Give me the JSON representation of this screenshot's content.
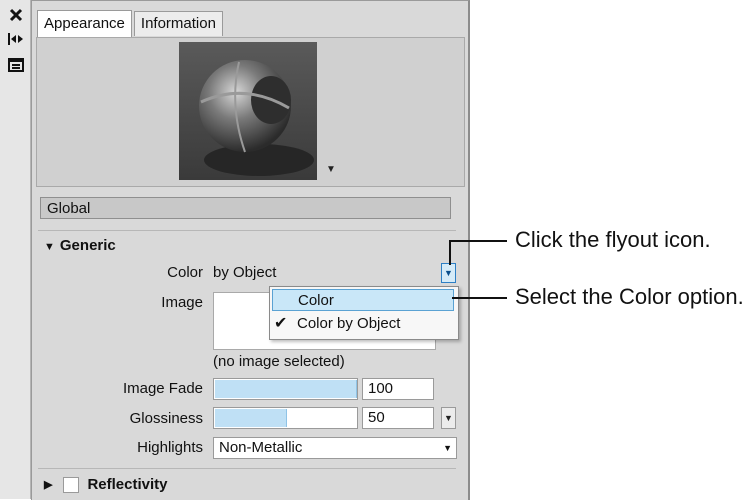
{
  "strip": {
    "icons": [
      "close-icon",
      "auto-hide-icon",
      "properties-menu-icon"
    ]
  },
  "tabs": [
    {
      "label": "Appearance",
      "active": true
    },
    {
      "label": "Information",
      "active": false
    }
  ],
  "preview": {
    "menu_icon": "dropdown-arrow-icon"
  },
  "global_label": "Global",
  "generic": {
    "header": "Generic",
    "color_label": "Color",
    "color_value": "by Object",
    "image_label": "Image",
    "image_status": "(no image selected)",
    "image_fade_label": "Image Fade",
    "image_fade_value": "100",
    "image_fade_fraction": 1.0,
    "glossiness_label": "Glossiness",
    "glossiness_value": "50",
    "glossiness_fraction": 0.5,
    "highlights_label": "Highlights",
    "highlights_value": "Non-Metallic"
  },
  "flyout_menu": {
    "items": [
      {
        "label": "Color",
        "highlighted": true,
        "checked": false
      },
      {
        "label": "Color by Object",
        "highlighted": false,
        "checked": true
      }
    ]
  },
  "reflectivity": {
    "label": "Reflectivity",
    "checked": false
  },
  "callouts": {
    "first": "Click the flyout icon.",
    "second": "Select the Color option."
  },
  "colors": {
    "accent": "#2d7fc4",
    "highlight": "#c9e7f8",
    "slider_fill": "#bfe0f5"
  }
}
